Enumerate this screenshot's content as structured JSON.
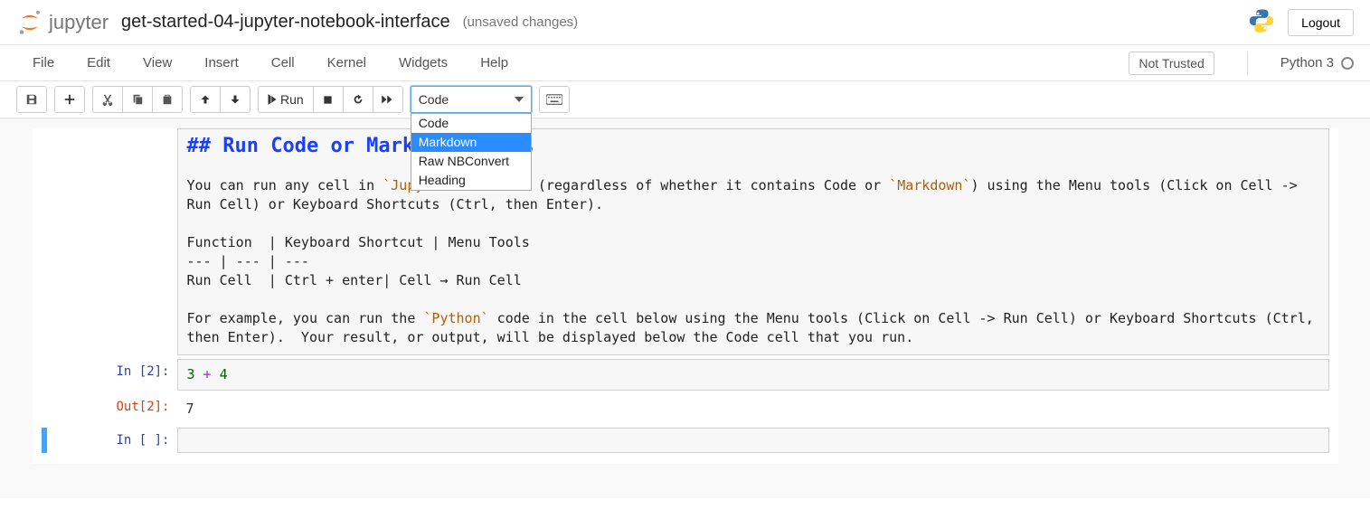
{
  "header": {
    "logo_text": "jupyter",
    "notebook_name": "get-started-04-jupyter-notebook-interface",
    "status": "(unsaved changes)",
    "logout": "Logout"
  },
  "menubar": {
    "items": [
      "File",
      "Edit",
      "View",
      "Insert",
      "Cell",
      "Kernel",
      "Widgets",
      "Help"
    ],
    "not_trusted": "Not Trusted",
    "kernel": "Python 3"
  },
  "toolbar": {
    "run_label": "Run",
    "cell_type_selected": "Code",
    "cell_type_options": [
      "Code",
      "Markdown",
      "Raw NBConvert",
      "Heading"
    ],
    "highlighted_option_index": 1
  },
  "cells": {
    "markdown_edit": {
      "heading": "## Run Code or Markdown Cells",
      "body1_a": "You can run any cell in ",
      "body1_code1": "`Jupyter Notebook`",
      "body1_b": " (regardless of whether it contains Code or ",
      "body1_code2": "`Markdown`",
      "body1_c": ") using the Menu tools (Click on Cell -> Run Cell) or Keyboard Shortcuts (Ctrl, then Enter).",
      "table_head": "Function  | Keyboard Shortcut | Menu Tools",
      "table_sep": "--- | --- | ---",
      "table_row": "Run Cell  | Ctrl + enter| Cell → Run Cell",
      "body2_a": "For example, you can run the ",
      "body2_code": "`Python`",
      "body2_b": " code in the cell below using the Menu tools (Click on Cell -> Run Cell) or Keyboard Shortcuts (Ctrl, then Enter).  Your result, or output, will be displayed below the Code cell that you run."
    },
    "code1": {
      "in_prompt": "In [2]:",
      "num1": "3",
      "op": " + ",
      "num2": "4",
      "out_prompt": "Out[2]:",
      "out_value": "7"
    },
    "code2": {
      "in_prompt": "In [ ]:"
    }
  }
}
